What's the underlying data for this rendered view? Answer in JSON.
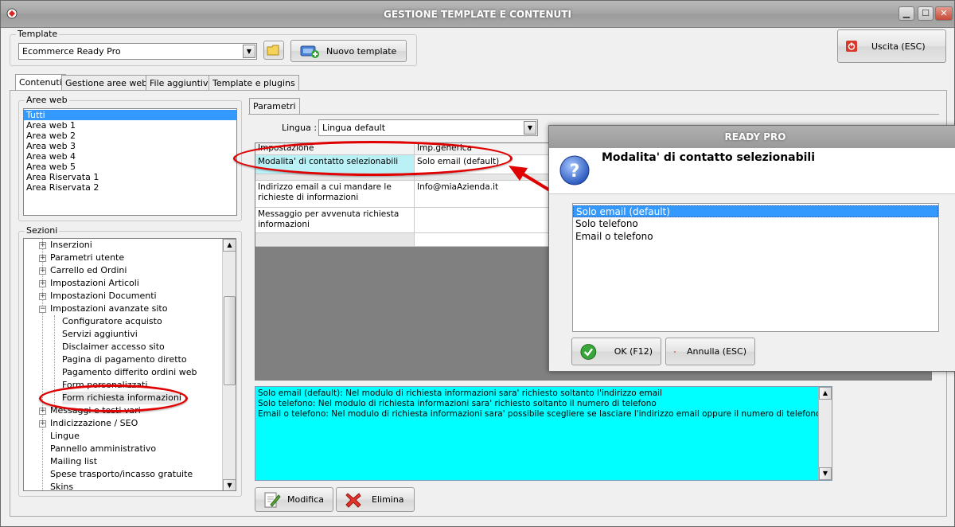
{
  "window": {
    "title": "GESTIONE TEMPLATE E CONTENUTI",
    "minimize": "▁",
    "maximize": "☐",
    "close": "✕"
  },
  "template": {
    "group_label": "Template",
    "selected": "Ecommerce Ready Pro",
    "new_template_label": "Nuovo template"
  },
  "exit_label": "Uscita (ESC)",
  "tabs": [
    "Contenuti",
    "Gestione aree web",
    "File aggiuntivi",
    "Template e plugins"
  ],
  "aree_web": {
    "label": "Aree web",
    "items": [
      "Tutti",
      "Area web 1",
      "Area web 2",
      "Area web 3",
      "Area web 4",
      "Area web 5",
      "Area Riservata 1",
      "Area Riservata 2"
    ]
  },
  "sezioni": {
    "label": "Sezioni",
    "items": [
      "Inserzioni",
      "Parametri utente",
      "Carrello ed Ordini",
      "Impostazioni Articoli",
      "Impostazioni Documenti",
      "Impostazioni avanzate sito",
      "Configuratore acquisto",
      "Servizi aggiuntivi",
      "Disclaimer accesso sito",
      "Pagina di pagamento diretto",
      "Pagamento differito ordini web",
      "Form personalizzati",
      "Form richiesta informazioni",
      "Messaggi e testi vari",
      "Indicizzazione / SEO",
      "Lingue",
      "Pannello amministrativo",
      "Mailing list",
      "Spese trasporto/incasso gratuite",
      "Skins"
    ]
  },
  "parametri": {
    "tab_label": "Parametri",
    "lingua_label": "Lingua :",
    "lingua_value": "Lingua default",
    "columns": [
      "Impostazione",
      "Imp.generica"
    ],
    "rows": [
      {
        "setting": "Modalita' di contatto selezionabili",
        "value": "Solo email (default)"
      },
      {
        "setting": "Indirizzo email a cui mandare le richieste di informazioni",
        "value": "Info@miaAzienda.it"
      },
      {
        "setting": "Messaggio per avvenuta richiesta informazioni",
        "value": ""
      }
    ],
    "description": [
      "Solo email (default): Nel modulo di richiesta informazioni sara' richiesto soltanto l'indirizzo email",
      "Solo telefono: Nel modulo di richiesta informazioni sara' richiesto soltanto il numero di telefono",
      "Email o telefono: Nel modulo di richiesta informazioni sara' possibile scegliere se lasciare l'indirizzo email oppure il numero di telefono"
    ],
    "modify_label": "Modifica",
    "delete_label": "Elimina"
  },
  "dialog": {
    "title": "READY PRO",
    "question": "Modalita' di contatto selezionabili",
    "options": [
      "Solo email (default)",
      "Solo telefono",
      "Email o telefono"
    ],
    "ok_label": "OK (F12)",
    "cancel_label": "Annulla (ESC)"
  },
  "colors": {
    "annotation_red": "#e00000",
    "selection_blue": "#3399ff",
    "description_bg": "#00ffff",
    "highlight_cell": "#b9f1f6"
  }
}
